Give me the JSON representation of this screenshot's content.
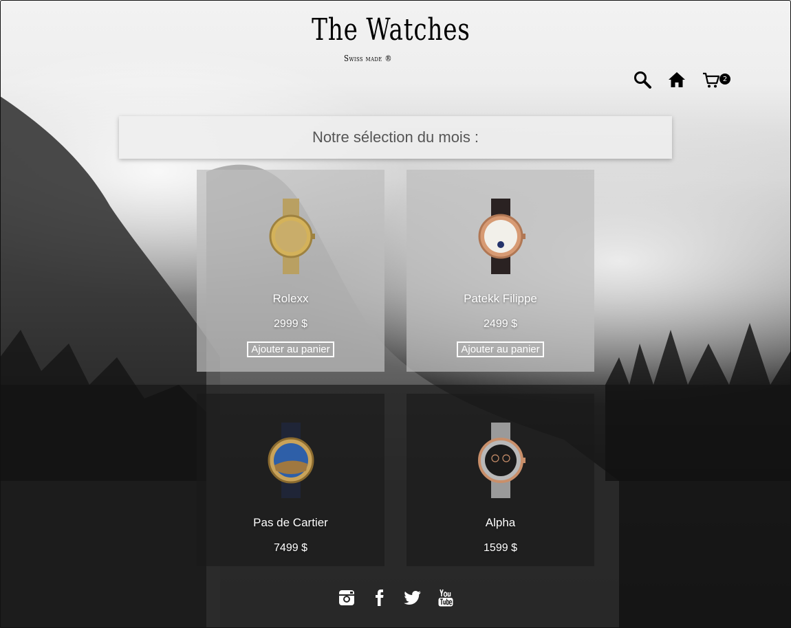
{
  "brand": {
    "title": "The Watches",
    "subtitle": "Swiss made ®"
  },
  "nav": {
    "icons": [
      "search-icon",
      "home-icon",
      "cart-icon"
    ],
    "cart_count": "2"
  },
  "banner": {
    "text": "Notre sélection du mois :"
  },
  "products": [
    {
      "name": "Rolexx",
      "price": "2999 $",
      "button": "Ajouter au panier",
      "dial_color": "#c9ad6a",
      "case_color": "#d4b25a",
      "strap_color": "#b9a062"
    },
    {
      "name": "Patekk Filippe",
      "price": "2499 $",
      "button": "Ajouter au panier",
      "dial_color": "#f2f0ea",
      "case_color": "#d79a73",
      "strap_color": "#2a2222"
    },
    {
      "name": "Pas de Cartier",
      "price": "7499 $",
      "dial_color": "#2e5fa8",
      "case_color": "#c9a35a",
      "strap_color": "#1f2537"
    },
    {
      "name": "Alpha",
      "price": "1599 $",
      "dial_color": "#1a1a1a",
      "case_color": "#b8b8b8",
      "strap_color": "#9a9a9a"
    }
  ],
  "footer": {
    "social": [
      "instagram-icon",
      "facebook-icon",
      "twitter-icon",
      "youtube-icon"
    ]
  }
}
